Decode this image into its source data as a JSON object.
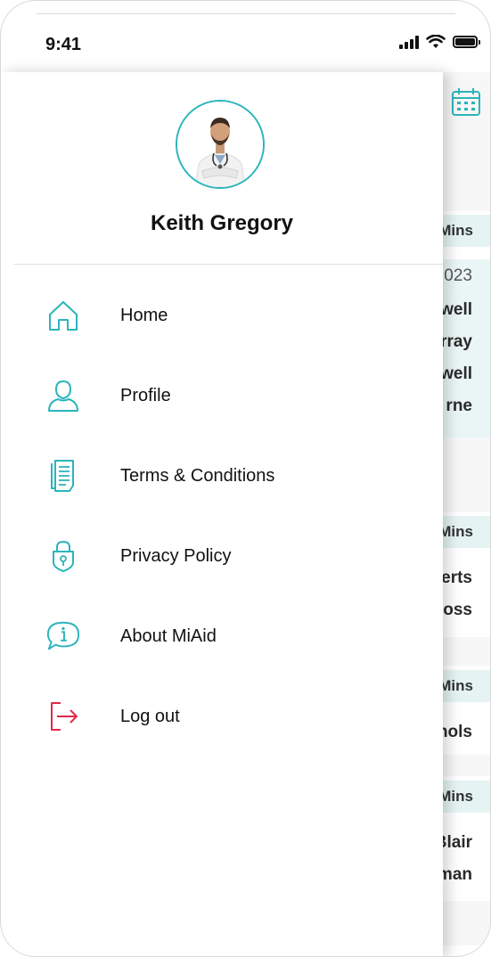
{
  "status_bar": {
    "time": "9:41"
  },
  "background": {
    "strips": [
      "Mins",
      "Mins",
      "Mins",
      "Mins"
    ],
    "texts": [
      "023",
      "well",
      "rray",
      "well",
      "rne",
      "erts",
      "oss",
      "hols",
      "Blair",
      "man"
    ]
  },
  "drawer": {
    "user": {
      "name": "Keith Gregory"
    },
    "menu": [
      {
        "label": "Home",
        "icon": "home-icon"
      },
      {
        "label": "Profile",
        "icon": "profile-icon"
      },
      {
        "label": "Terms & Conditions",
        "icon": "document-icon"
      },
      {
        "label": "Privacy Policy",
        "icon": "lock-icon"
      },
      {
        "label": "About MiAid",
        "icon": "info-icon"
      },
      {
        "label": "Log out",
        "icon": "logout-icon"
      }
    ]
  },
  "colors": {
    "accent": "#2bb5bc",
    "logout": "#e0294a",
    "strip": "#e5f4f3"
  }
}
